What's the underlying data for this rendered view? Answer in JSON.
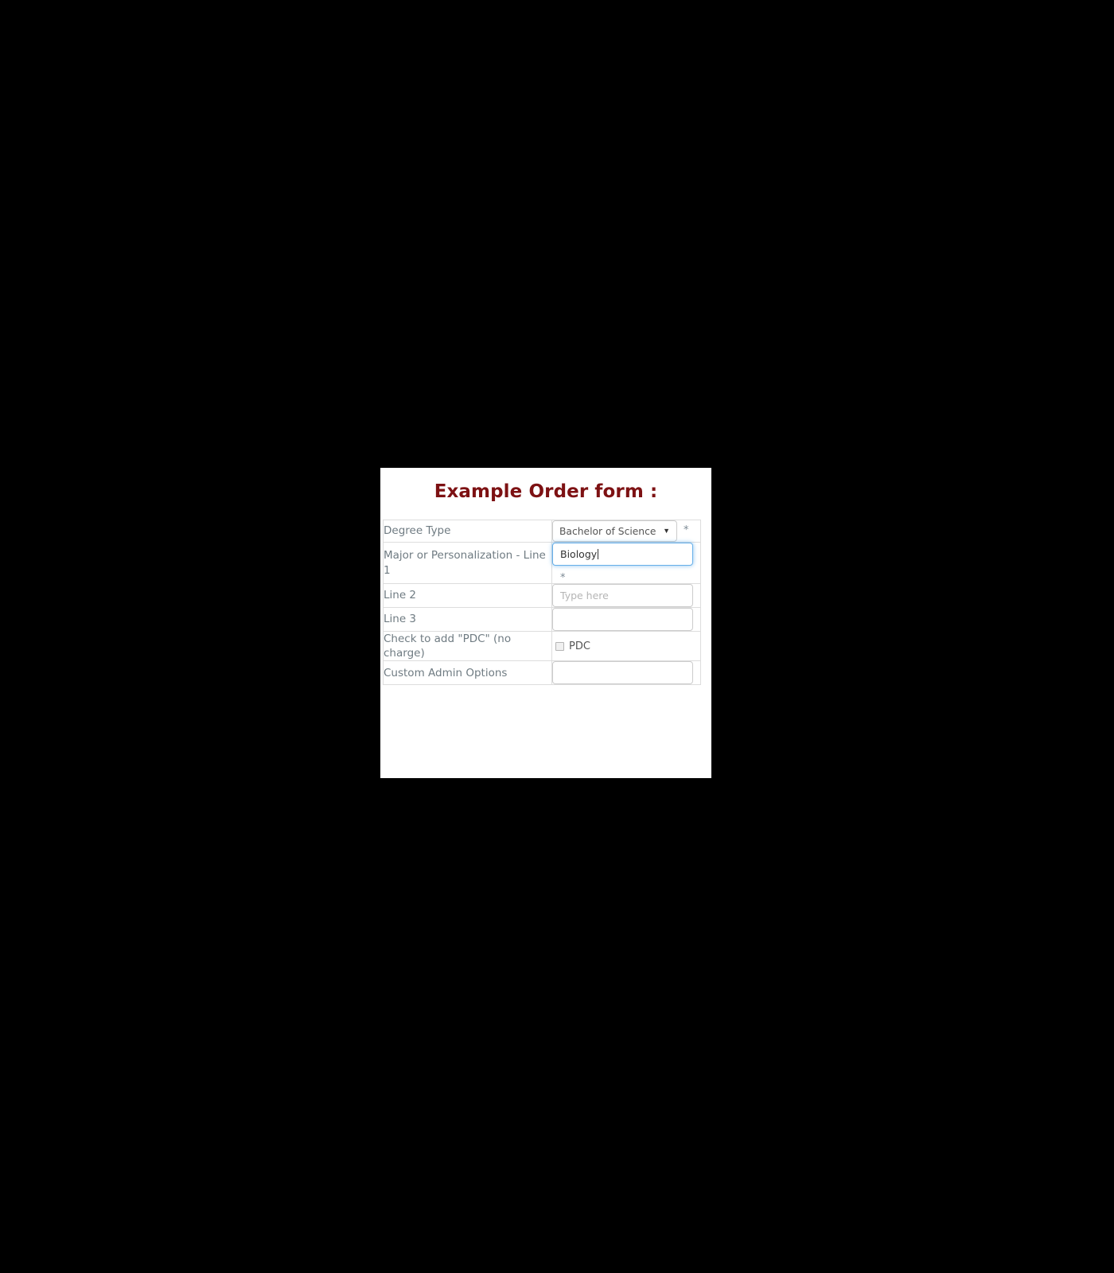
{
  "page": {
    "background_color": "#000000"
  },
  "form": {
    "title": "Example Order form :",
    "title_color": "#7d1113",
    "card_background": "#ffffff",
    "required_marker": "*",
    "rows": [
      {
        "label": "Degree Type",
        "field_type": "select",
        "selected_value": "Bachelor of Science",
        "dropdown_arrow": "▼",
        "required": true,
        "required_position": "inline"
      },
      {
        "label": "Major or Personalization - Line 1",
        "field_type": "text",
        "value": "Biology",
        "placeholder": "",
        "focused": true,
        "required": true,
        "required_position": "below"
      },
      {
        "label": "Line 2",
        "field_type": "text",
        "value": "",
        "placeholder": "Type here",
        "focused": false,
        "required": false
      },
      {
        "label": "Line 3",
        "field_type": "text",
        "value": "",
        "placeholder": "",
        "focused": false,
        "required": false
      },
      {
        "label": "Check to add \"PDC\" (no charge)",
        "field_type": "checkbox",
        "checkbox_label": "PDC",
        "checked": false,
        "required": false
      },
      {
        "label": "Custom Admin Options",
        "field_type": "text",
        "value": "",
        "placeholder": "",
        "focused": false,
        "required": false
      }
    ]
  }
}
